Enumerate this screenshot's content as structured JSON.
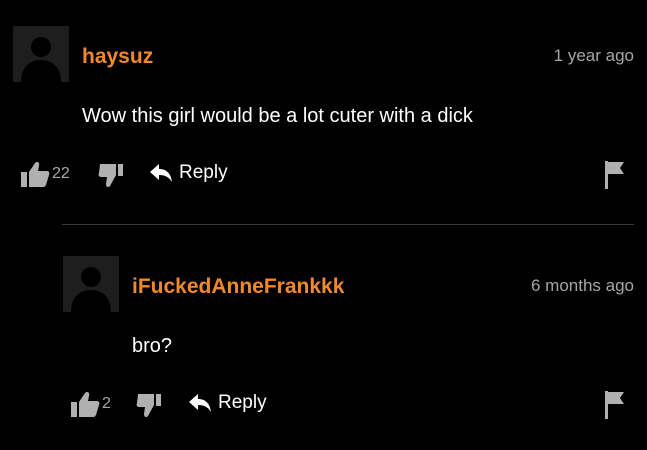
{
  "colors": {
    "background": "#000000",
    "username": "#f0892d",
    "meta_text": "#a6a6a6",
    "body_text": "#ffffff",
    "icon": "#b0b0b0",
    "divider": "#3a3a3a"
  },
  "comments": [
    {
      "username": "haysuz",
      "timestamp": "1 year ago",
      "text": "Wow this girl would be a lot cuter with a dick",
      "likes": "22",
      "reply_label": "Reply",
      "icons": [
        "avatar-placeholder",
        "thumbs-up-icon",
        "thumbs-down-icon",
        "reply-arrow-icon",
        "flag-icon"
      ]
    },
    {
      "username": "iFuckedAnneFrankkk",
      "timestamp": "6 months ago",
      "text": "bro?",
      "likes": "2",
      "reply_label": "Reply",
      "icons": [
        "avatar-placeholder",
        "thumbs-up-icon",
        "thumbs-down-icon",
        "reply-arrow-icon",
        "flag-icon"
      ]
    }
  ]
}
